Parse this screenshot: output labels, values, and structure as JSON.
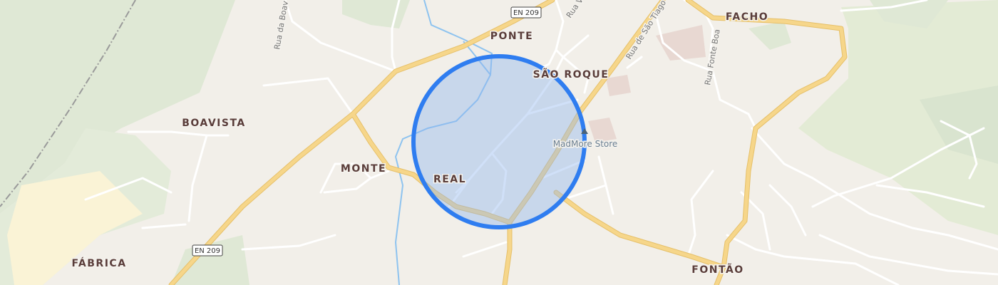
{
  "map": {
    "places": {
      "ponte": "PONTE",
      "sao_roque": "SÃO ROQUE",
      "facho": "FACHO",
      "boavista": "BOAVISTA",
      "monte": "MONTE",
      "real": "REAL",
      "fabrica": "FÁBRICA",
      "fontao": "FONTÃO"
    },
    "streets": {
      "rua_da_boavista": "Rua da Boav",
      "rua_v": "Rua V",
      "rua_sao_tiago": "Rua de São Tiago",
      "rua_fonte_boa": "Rua Fonte Boa"
    },
    "roads": {
      "en209_top": "EN 209",
      "en209_left": "EN 209"
    },
    "pois": {
      "madmore": "MadMore Store"
    },
    "colors": {
      "background": "#f2efe9",
      "main_road": "#f6d68a",
      "minor_road": "#ffffff",
      "water": "#8ec3ef",
      "green": "#dfe8d5",
      "farmland": "#faf3d6",
      "radius_fill": "#8fb4ee",
      "radius_stroke": "#2f7df0",
      "railway": "#9a9a9a"
    },
    "icons": [
      "railway-line",
      "map-pin-icon",
      "location-accuracy-circle"
    ]
  }
}
